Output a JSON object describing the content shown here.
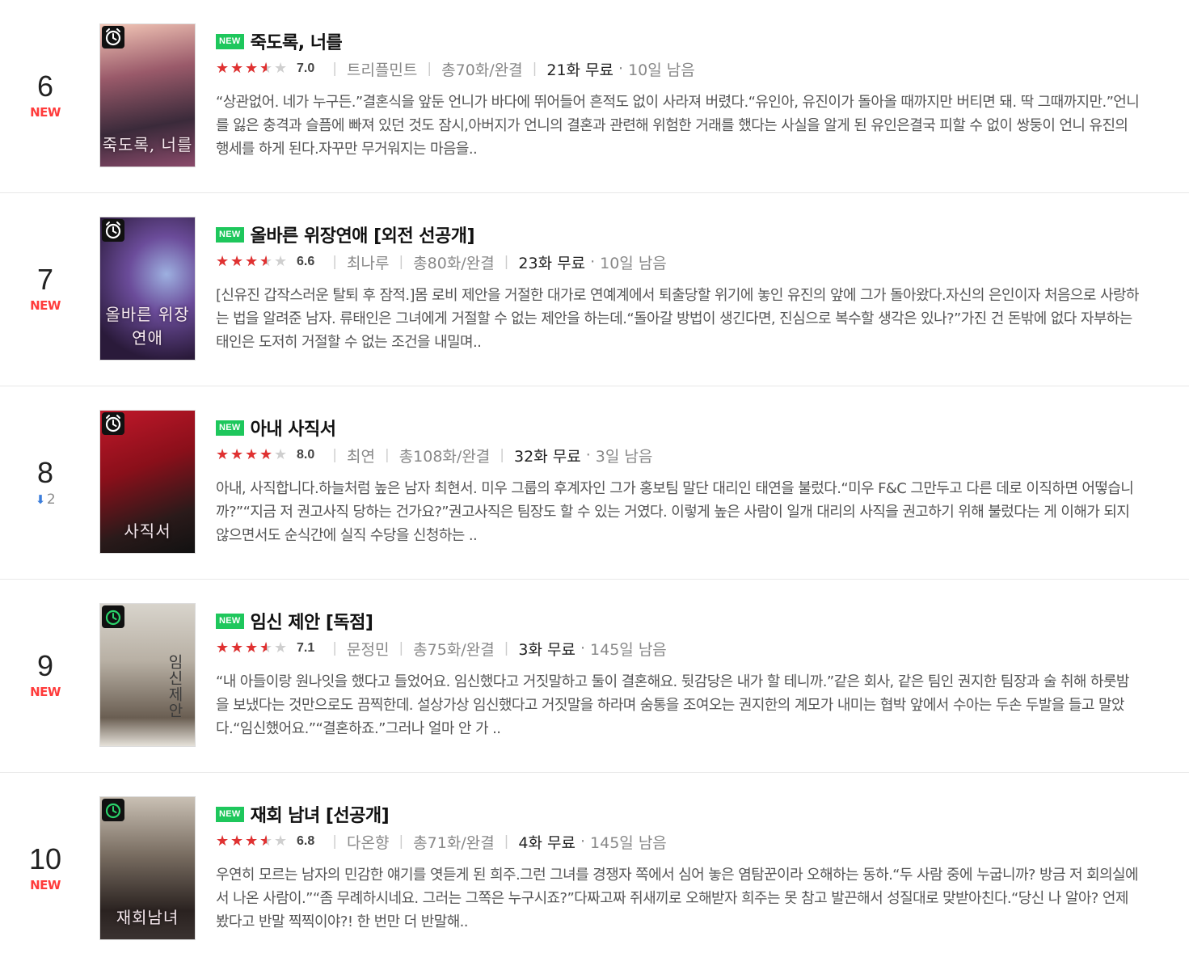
{
  "items": [
    {
      "rank": "6",
      "rank_change": "NEW",
      "rank_change_type": "new",
      "badge": "NEW",
      "title": "죽도록, 너를",
      "rating": 3.5,
      "score": "7.0",
      "author": "트리플민트",
      "episodes": "총70화/완결",
      "free": "21화 무료",
      "remain": "10일 남음",
      "cover_title": "죽도록, 너를",
      "cover_badge": "alarm-icon",
      "description": "“상관없어. 네가 누구든.”결혼식을 앞둔 언니가 바다에 뛰어들어 흔적도 없이 사라져 버렸다.“유인아, 유진이가 돌아올 때까지만 버티면 돼. 딱 그때까지만.”언니를 잃은 충격과 슬픔에 빠져 있던 것도 잠시,아버지가 언니의 결혼과 관련해 위험한 거래를 했다는 사실을 알게 된 유인은결국 피할 수 없이 쌍둥이 언니 유진의 행세를 하게 된다.자꾸만 무거워지는 마음을.."
    },
    {
      "rank": "7",
      "rank_change": "NEW",
      "rank_change_type": "new",
      "badge": "NEW",
      "title": "올바른 위장연애 [외전 선공개]",
      "rating": 3.5,
      "score": "6.6",
      "author": "최나루",
      "episodes": "총80화/완결",
      "free": "23화 무료",
      "remain": "10일 남음",
      "cover_title": "올바른 위장연애",
      "cover_badge": "alarm-icon",
      "description": "[신유진 갑작스러운 탈퇴 후 잠적.]몸 로비 제안을 거절한 대가로 연예계에서 퇴출당할 위기에 놓인 유진의 앞에 그가 돌아왔다.자신의 은인이자 처음으로 사랑하는 법을 알려준 남자. 류태인은 그녀에게 거절할 수 없는 제안을 하는데.“돌아갈 방법이 생긴다면, 진심으로 복수할 생각은 있나?”가진 건 돈밖에 없다 자부하는 태인은 도저히 거절할 수 없는 조건을 내밀며.."
    },
    {
      "rank": "8",
      "rank_change": "2",
      "rank_change_type": "down",
      "badge": "NEW",
      "title": "아내 사직서",
      "rating": 4,
      "score": "8.0",
      "author": "최연",
      "episodes": "총108화/완결",
      "free": "32화 무료",
      "remain": "3일 남음",
      "cover_title": "사직서",
      "cover_badge": "alarm-icon",
      "description": "아내, 사직합니다.하늘처럼 높은 남자 최현서. 미우 그룹의 후계자인 그가 홍보팀 말단 대리인 태연을 불렀다.“미우 F&C 그만두고 다른 데로 이직하면 어떻습니까?”“지금 저 권고사직 당하는 건가요?”권고사직은 팀장도 할 수 있는 거였다. 이렇게 높은 사람이 일개 대리의 사직을 권고하기 위해 불렀다는 게 이해가 되지 않으면서도 순식간에 실직 수당을 신청하는 .."
    },
    {
      "rank": "9",
      "rank_change": "NEW",
      "rank_change_type": "new",
      "badge": "NEW",
      "title": "임신 제안 [독점]",
      "rating": 3.5,
      "score": "7.1",
      "author": "문정민",
      "episodes": "총75화/완결",
      "free": "3화 무료",
      "remain": "145일 남음",
      "cover_title": "임신제안",
      "cover_badge": "timer-icon",
      "description": "“내 아들이랑 원나잇을 했다고 들었어요. 임신했다고 거짓말하고 둘이 결혼해요. 뒷감당은 내가 할 테니까.”같은 회사, 같은 팀인 권지한 팀장과 술 취해 하룻밤을 보냈다는 것만으로도 끔찍한데. 설상가상 임신했다고 거짓말을 하라며 숨통을 조여오는 권지한의 계모가 내미는 협박 앞에서 수아는 두손 두발을 들고 말았다.“임신했어요.”“결혼하죠.”그러나 얼마 안 가 .."
    },
    {
      "rank": "10",
      "rank_change": "NEW",
      "rank_change_type": "new",
      "badge": "NEW",
      "title": "재회 남녀 [선공개]",
      "rating": 3.5,
      "score": "6.8",
      "author": "다온향",
      "episodes": "총71화/완결",
      "free": "4화 무료",
      "remain": "145일 남음",
      "cover_title": "재회남녀",
      "cover_badge": "timer-icon",
      "description": "우연히 모르는 남자의 민감한 얘기를 엿듣게 된 희주.그런 그녀를 경쟁자 쪽에서 심어 놓은 염탐꾼이라 오해하는 동하.“두 사람 중에 누굽니까? 방금 저 회의실에서 나온 사람이.”“좀 무례하시네요. 그러는 그쪽은 누구시죠?”다짜고짜 쥐새끼로 오해받자 희주는 못 참고 발끈해서 성질대로 맞받아친다.“당신 나 알아? 언제 봤다고 반말 찍찍이야?! 한 번만 더 반말해.."
    }
  ],
  "colors": {
    "new_badge": "#1ec75c",
    "rank_new": "#ff3b3b",
    "rank_down": "#3b7ddb",
    "star": "#e03131"
  }
}
